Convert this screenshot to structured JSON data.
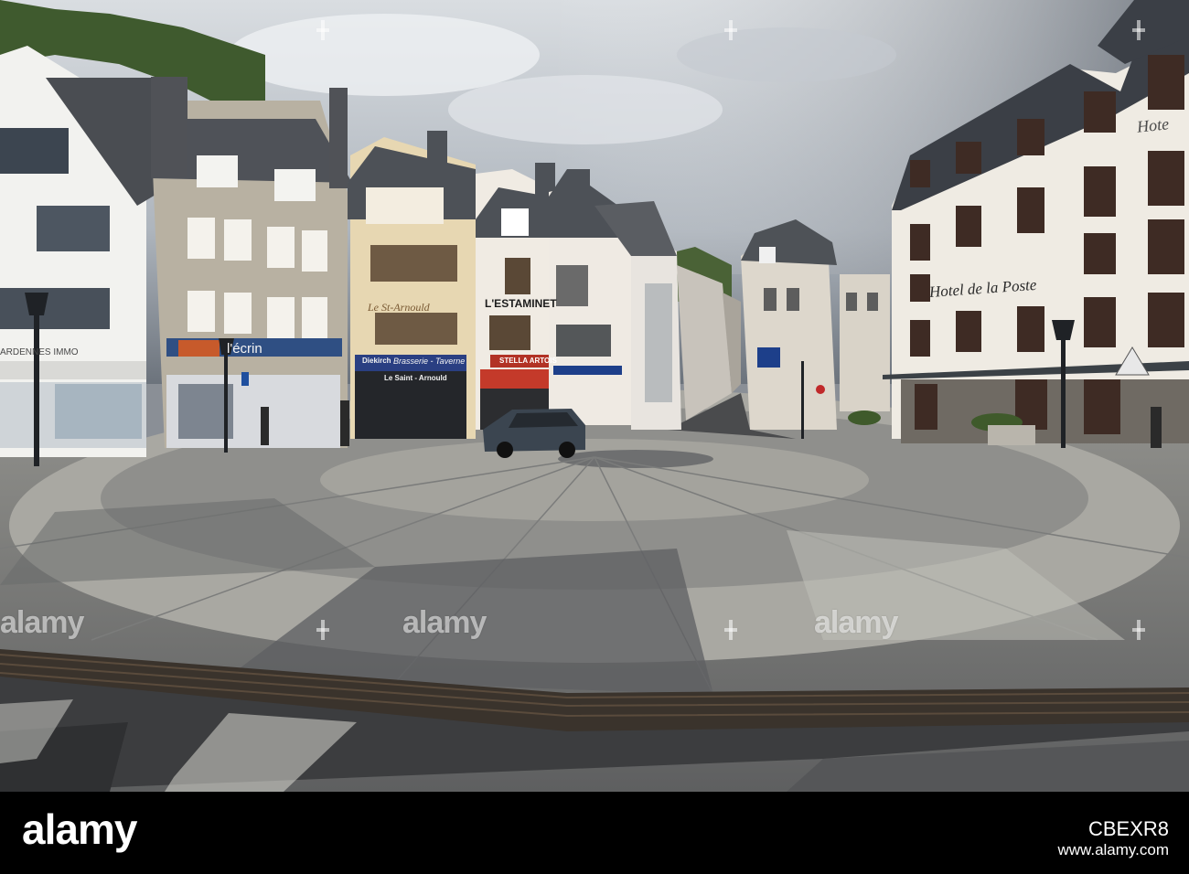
{
  "signs": {
    "ecrin": "l'écrin",
    "le_st_arnould": "Le St-Arnould",
    "diekirch": "Diekirch",
    "brasserie": "Brasserie - Taverne",
    "le_saint_arnould": "Le Saint - Arnould",
    "estaminet": "L'ESTAMINET",
    "stella": "STELLA ARTOIS",
    "immo": "ARDENNES IMMO",
    "hotel_de_la_poste": "Hotel de la Poste",
    "hotel_corner": "Hote"
  },
  "watermark": {
    "text": "alamy"
  },
  "footer": {
    "logo": "alamy",
    "image_id": "CBEXR8",
    "website": "www.alamy.com"
  },
  "colors": {
    "sky": "#c9ced4",
    "pavement_light": "#b3b1aa",
    "pavement_dark": "#6c6e70",
    "footer_bg": "#000000"
  }
}
